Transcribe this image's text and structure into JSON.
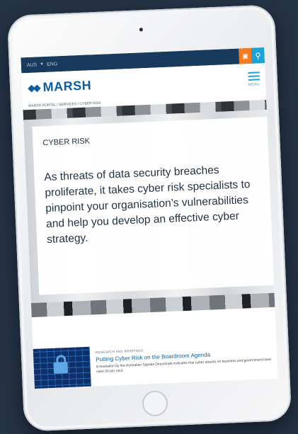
{
  "topbar": {
    "country": "AUS",
    "language": "ENG"
  },
  "header": {
    "brand": "MARSH",
    "menu_label": "MENU"
  },
  "breadcrumb": "MARSH PORTAL / SERVICES / CYBER RISK",
  "hero": {
    "title": "CYBER RISK",
    "text": "As threats of data security breaches proliferate, it takes cyber risk specialists to pinpoint your organisation’s vulnerabilities and help you develop an effective cyber strategy."
  },
  "article": {
    "tag": "RESEARCH AND BRIEFINGS",
    "title": "Putting Cyber Risk on the Boardroom Agenda",
    "summary": "A revelation by the Australian Signals Directorate indicates that cyber attacks on business and government have risen 20 per cent."
  },
  "icons": {
    "user": "user-icon",
    "search": "search-icon",
    "menu": "hamburger-menu-icon",
    "lock": "lock-icon"
  },
  "colors": {
    "background": "#243245",
    "topbar": "#183a5c",
    "brand": "#0b5fa5",
    "accent_orange": "#f47b20",
    "accent_cyan": "#1ba2d9"
  }
}
